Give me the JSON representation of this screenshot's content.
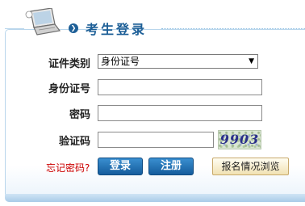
{
  "header": {
    "title": "考生登录",
    "icon": "laptop-icon"
  },
  "form": {
    "id_type": {
      "label": "证件类别",
      "selected": "身份证号"
    },
    "id_number": {
      "label": "身份证号",
      "value": ""
    },
    "password": {
      "label": "密码",
      "value": ""
    },
    "captcha": {
      "label": "验证码",
      "value": "",
      "image_text": "9903"
    }
  },
  "actions": {
    "forgot": "忘记密码?",
    "login": "登录",
    "register": "注册",
    "browse": "报名情况浏览"
  },
  "colors": {
    "accent": "#1d5f97",
    "link": "#cc0000",
    "border": "#b9d6ec"
  }
}
